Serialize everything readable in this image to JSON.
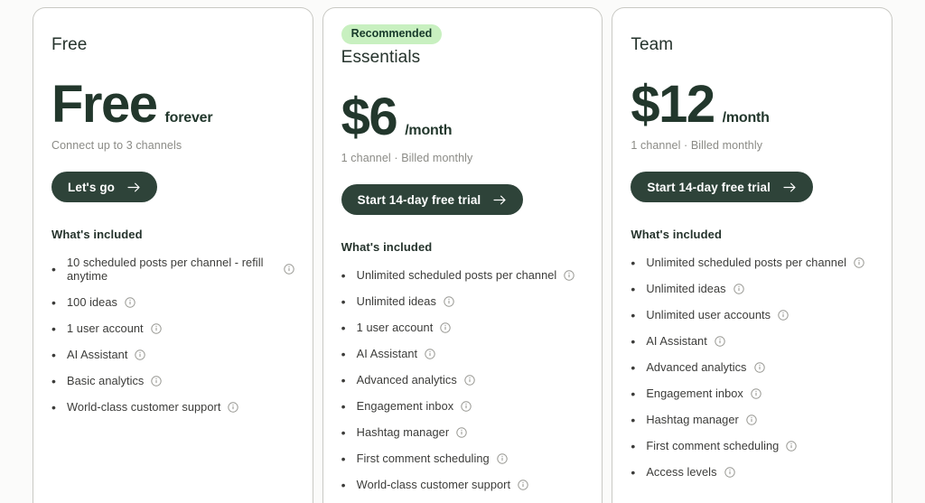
{
  "theme": {
    "page_background": "#fbfbfa",
    "card_background": "#ffffff",
    "card_border": "#c9c9c4",
    "button_fill": "#2e4339",
    "button_text": "#ffffff",
    "badge_fill": "#c8f0c0",
    "badge_text": "#173a2a",
    "price_text": "#22372c",
    "muted_text": "#8b8b86"
  },
  "common": {
    "included_title": "What's included",
    "info_icon": "info-circle-icon",
    "bullet": "•",
    "arrow_icon": "arrow-right-icon"
  },
  "plans": [
    {
      "name": "Free",
      "badge": null,
      "price_amount": "Free",
      "price_suffix": "forever",
      "price_note": "Connect up to 3 channels",
      "cta_label": "Let's go",
      "features": [
        "10 scheduled posts per channel - refill anytime",
        "100 ideas",
        "1 user account",
        "AI Assistant",
        "Basic analytics",
        "World-class customer support"
      ]
    },
    {
      "name": "Essentials",
      "badge": "Recommended",
      "price_amount": "$6",
      "price_suffix": "/month",
      "price_note": "1 channel · Billed monthly",
      "cta_label": "Start 14-day free trial",
      "features": [
        "Unlimited scheduled posts per channel",
        "Unlimited ideas",
        "1 user account",
        "AI Assistant",
        "Advanced analytics",
        "Engagement inbox",
        "Hashtag manager",
        "First comment scheduling",
        "World-class customer support"
      ]
    },
    {
      "name": "Team",
      "badge": null,
      "price_amount": "$12",
      "price_suffix": "/month",
      "price_note": "1 channel · Billed monthly",
      "cta_label": "Start 14-day free trial",
      "features": [
        "Unlimited scheduled posts per channel",
        "Unlimited ideas",
        "Unlimited user accounts",
        "AI Assistant",
        "Advanced analytics",
        "Engagement inbox",
        "Hashtag manager",
        "First comment scheduling",
        "Access levels"
      ]
    }
  ]
}
